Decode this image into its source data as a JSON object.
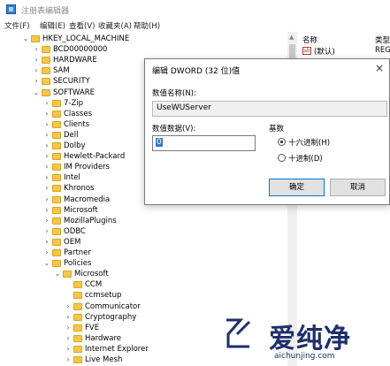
{
  "window": {
    "title": "注册表编辑器",
    "icon": "registry-editor-icon"
  },
  "menubar": [
    "文件(F)",
    "编辑(E)",
    "查看(V)",
    "收藏夹(A)",
    "帮助(H)"
  ],
  "tree": [
    {
      "label": "HKEY_LOCAL_MACHINE",
      "depth": 0,
      "expanded": true
    },
    {
      "label": "BCD00000000",
      "depth": 1,
      "expanded": false
    },
    {
      "label": "HARDWARE",
      "depth": 1,
      "expanded": false
    },
    {
      "label": "SAM",
      "depth": 1,
      "expanded": false
    },
    {
      "label": "SECURITY",
      "depth": 1,
      "expanded": false
    },
    {
      "label": "SOFTWARE",
      "depth": 1,
      "expanded": true
    },
    {
      "label": "7-Zip",
      "depth": 2,
      "expanded": false
    },
    {
      "label": "Classes",
      "depth": 2,
      "expanded": false
    },
    {
      "label": "Clients",
      "depth": 2,
      "expanded": false
    },
    {
      "label": "Dell",
      "depth": 2,
      "expanded": false
    },
    {
      "label": "Dolby",
      "depth": 2,
      "expanded": false
    },
    {
      "label": "Hewlett-Packard",
      "depth": 2,
      "expanded": false
    },
    {
      "label": "IM Providers",
      "depth": 2,
      "expanded": false
    },
    {
      "label": "Intel",
      "depth": 2,
      "expanded": false
    },
    {
      "label": "Khronos",
      "depth": 2,
      "expanded": false
    },
    {
      "label": "Macromedia",
      "depth": 2,
      "expanded": false
    },
    {
      "label": "Microsoft",
      "depth": 2,
      "expanded": false
    },
    {
      "label": "MozillaPlugins",
      "depth": 2,
      "expanded": false
    },
    {
      "label": "ODBC",
      "depth": 2,
      "expanded": false
    },
    {
      "label": "OEM",
      "depth": 2,
      "expanded": false
    },
    {
      "label": "Partner",
      "depth": 2,
      "expanded": false
    },
    {
      "label": "Policies",
      "depth": 2,
      "expanded": true
    },
    {
      "label": "Microsoft",
      "depth": 3,
      "expanded": true
    },
    {
      "label": "CCM",
      "depth": 4,
      "expanded": null
    },
    {
      "label": "ccmsetup",
      "depth": 4,
      "expanded": null
    },
    {
      "label": "Communicator",
      "depth": 4,
      "expanded": false
    },
    {
      "label": "Cryptography",
      "depth": 4,
      "expanded": false
    },
    {
      "label": "FVE",
      "depth": 4,
      "expanded": false
    },
    {
      "label": "Hardware",
      "depth": 4,
      "expanded": false
    },
    {
      "label": "Internet Explorer",
      "depth": 4,
      "expanded": false
    },
    {
      "label": "Live Mesh",
      "depth": 4,
      "expanded": false
    }
  ],
  "list": {
    "col_name": "名称",
    "col_type": "类型",
    "rows": [
      {
        "name": "(默认)",
        "type": "REG"
      }
    ]
  },
  "dialog": {
    "title": "编辑 DWORD (32 位)值",
    "close": "×",
    "value_name_label": "数值名称(N):",
    "value_name": "UseWUServer",
    "value_data_label": "数值数据(V):",
    "value_data": "0",
    "radix_label": "基数",
    "radix_options": [
      "十六进制(H)",
      "十进制(D)"
    ],
    "radix_selected": 0,
    "ok": "确定",
    "cancel": "取消"
  },
  "watermark": {
    "brand": "爱纯净",
    "site": "aichunjing.com"
  }
}
